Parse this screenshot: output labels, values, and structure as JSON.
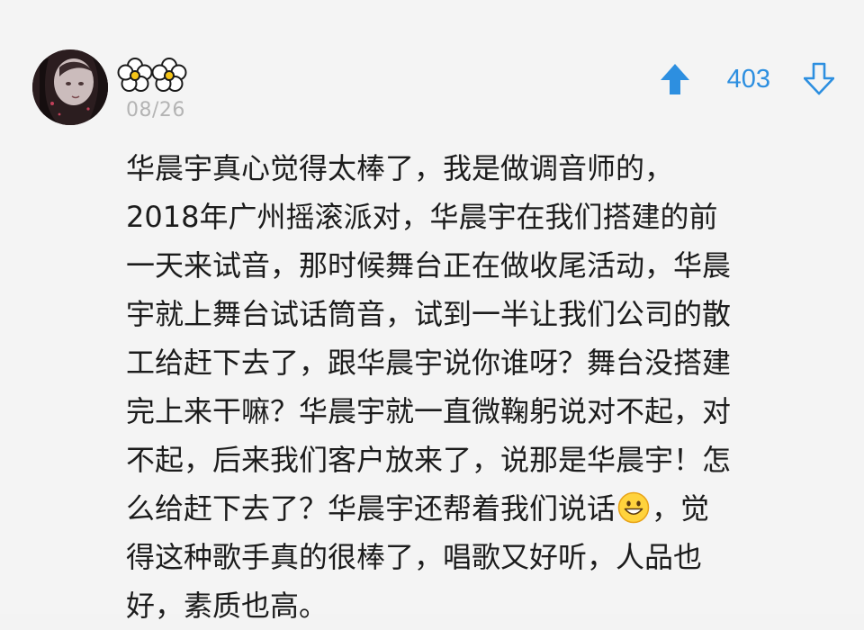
{
  "comment": {
    "username_icon": "flower-nickname-icon",
    "date": "08/26",
    "upvote_icon": "arrow-up-icon",
    "vote_count": "403",
    "downvote_icon": "arrow-down-icon",
    "lines": [
      "华晨宇真心觉得太棒了，我是做调音师的，",
      "2018年广州摇滚派对，华晨宇在我们搭建的前",
      "一天来试音，那时候舞台正在做收尾活动，华晨",
      "宇就上舞台试话筒音，试到一半让我们公司的散",
      "工给赶下去了，跟华晨宇说你谁呀？舞台没搭建",
      "完上来干嘛？华晨宇就一直微鞠躬说对不起，对",
      "不起，后来我们客户放来了，说那是华晨宇！怎",
      "么给赶下去了？华晨宇还帮着我们说话",
      "，觉",
      "得这种歌手真的很棒了，唱歌又好听，人品也",
      "好，素质也高。"
    ],
    "emoji_icon": "grinning-face-emoji-icon"
  },
  "colors": {
    "accent": "#2d8fe0",
    "date": "#b4b4b4",
    "text": "#1c1c1c",
    "background": "#f4f4f4"
  }
}
